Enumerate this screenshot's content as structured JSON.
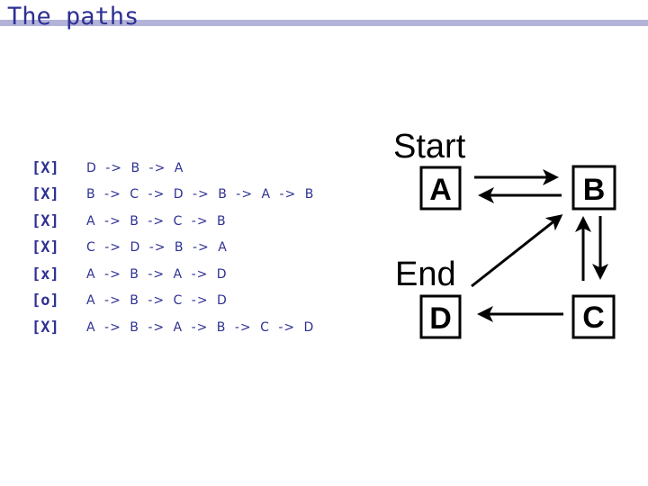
{
  "header": {
    "title": "The paths"
  },
  "paths": [
    {
      "mark": "[X]",
      "sequence": "D -> B -> A"
    },
    {
      "mark": "[X]",
      "sequence": "B -> C -> D -> B -> A -> B"
    },
    {
      "mark": "[X]",
      "sequence": "A -> B -> C -> B"
    },
    {
      "mark": "[X]",
      "sequence": "C -> D -> B -> A"
    },
    {
      "mark": "[x]",
      "sequence": "A -> B -> A -> D"
    },
    {
      "mark": "[o]",
      "sequence": "A -> B -> C -> D"
    },
    {
      "mark": "[X]",
      "sequence": "A -> B -> A -> B -> C -> D"
    }
  ],
  "diagram": {
    "start_label": "Start",
    "end_label": "End",
    "nodes": [
      {
        "id": "A",
        "label": "A"
      },
      {
        "id": "B",
        "label": "B"
      },
      {
        "id": "C",
        "label": "C"
      },
      {
        "id": "D",
        "label": "D"
      }
    ],
    "edges": [
      {
        "from": "A",
        "to": "B"
      },
      {
        "from": "B",
        "to": "A"
      },
      {
        "from": "B",
        "to": "C"
      },
      {
        "from": "C",
        "to": "B"
      },
      {
        "from": "C",
        "to": "D"
      },
      {
        "from": "D",
        "to": "B"
      }
    ]
  },
  "colors": {
    "title": "#2e3192",
    "title_bar": "#b3b3d9",
    "list_text": "#2e3192",
    "diagram": "#000000"
  }
}
